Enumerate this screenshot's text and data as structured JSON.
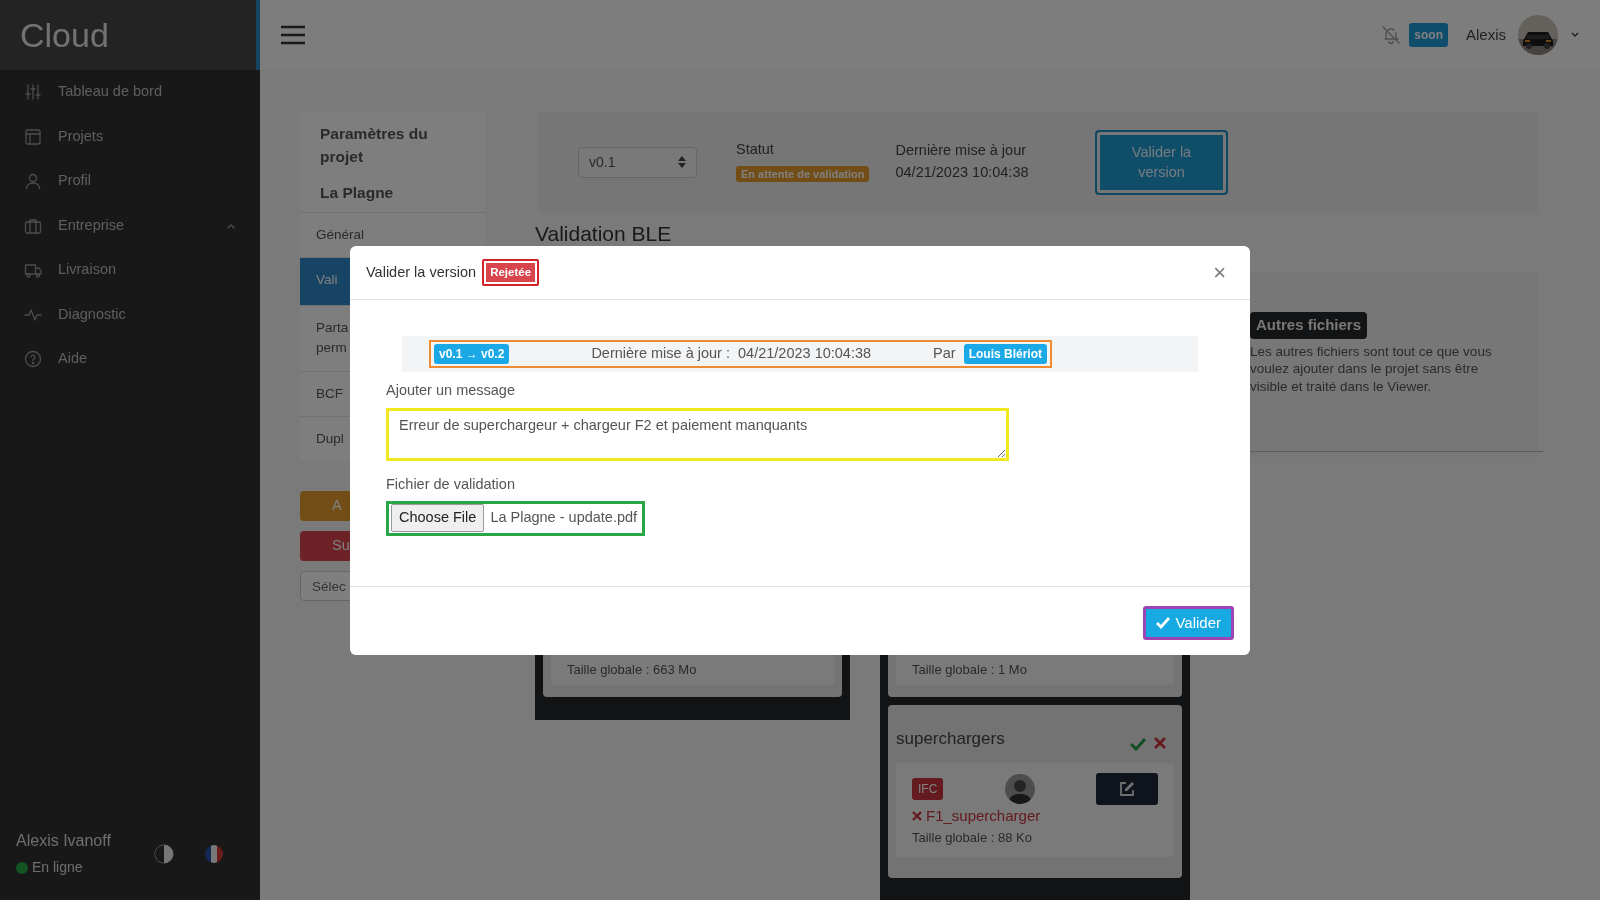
{
  "sidebar": {
    "brand": "Cloud",
    "items": [
      {
        "label": "Tableau de bord"
      },
      {
        "label": "Projets"
      },
      {
        "label": "Profil"
      },
      {
        "label": "Entreprise",
        "expanded": true
      },
      {
        "label": "Livraison"
      },
      {
        "label": "Diagnostic"
      },
      {
        "label": "Aide"
      }
    ],
    "user": {
      "name": "Alexis Ivanoff",
      "status": "En ligne",
      "online": true
    }
  },
  "header": {
    "notifications_badge": "soon",
    "user_name": "Alexis"
  },
  "project_nav": {
    "title": "Paramètres du projet",
    "project": "La Plagne",
    "items": [
      {
        "label": "Général",
        "selected": false
      },
      {
        "label": "Vali",
        "selected": true
      },
      {
        "label": "Parta perm",
        "selected": false
      },
      {
        "label": "BCF",
        "selected": false
      },
      {
        "label": "Dupl",
        "selected": false
      }
    ],
    "actions": [
      {
        "label": "A",
        "kind": "warning"
      },
      {
        "label": "Su",
        "kind": "danger"
      }
    ],
    "select": {
      "value": "Sélec"
    }
  },
  "version_bar": {
    "version": "v0.1",
    "status_label": "Statut",
    "status": "En attente de validation",
    "updated_label": "Dernière mise à jour",
    "updated": "04/21/2023 10:04:38",
    "button": "Valider la version"
  },
  "section_title": "Validation BLE",
  "other_files": {
    "title": "Autres fichiers",
    "description": "Les autres fichiers sont tout ce que vous voulez ajouter dans le projet sans être visible et traité dans le Viewer."
  },
  "columns": [
    {
      "groups": [
        {
          "size": "Taille globale : 663 Mo"
        }
      ]
    },
    {
      "groups": [
        {
          "size": "Taille globale : 1 Mo"
        },
        {
          "name": "superchargers",
          "files": [
            {
              "type": "IFC",
              "name": "F1_supercharger",
              "size": "Taille globale : 88 Ko",
              "valid": false
            }
          ]
        }
      ]
    }
  ],
  "modal": {
    "title": "Valider la version",
    "status": "Rejetée",
    "close": "×",
    "version_change": "v0.1 → v0.2",
    "updated_label": "Dernière mise à jour :",
    "updated": "04/21/2023 10:04:38",
    "by_label": "Par",
    "author": "Louis Blériot",
    "message_label": "Ajouter un message",
    "message": "Erreur de superchargeur + chargeur F2 et paiement manquants",
    "file_label": "Fichier de validation",
    "file_button": "Choose File",
    "file_name": "La Plagne - update.pdf",
    "submit": "Valider"
  }
}
